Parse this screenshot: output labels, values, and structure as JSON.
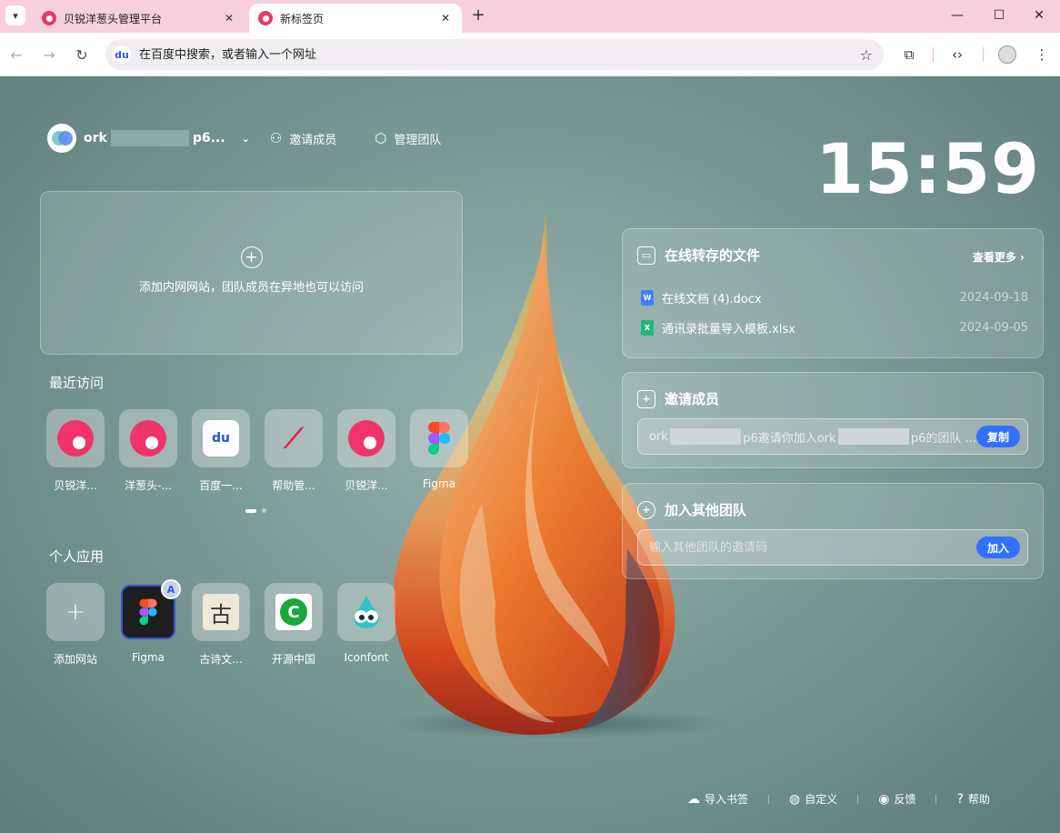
{
  "tabs": [
    {
      "label": "贝锐洋葱头管理平台",
      "active": false
    },
    {
      "label": "新标签页",
      "active": true
    }
  ],
  "omnibox": {
    "placeholder": "在百度中搜索，或者输入一个网址"
  },
  "team": {
    "name_start": "ork",
    "name_end": "p6...",
    "invite_label": "邀请成员",
    "manage_label": "管理团队"
  },
  "clock": "15:59",
  "intranet": {
    "hint": "添加内网网站，团队成员在异地也可以访问"
  },
  "recent": {
    "title": "最近访问",
    "items": [
      {
        "label": "贝锐洋...",
        "icon": "onion-logo"
      },
      {
        "label": "洋葱头-...",
        "icon": "onion-logo"
      },
      {
        "label": "百度一...",
        "icon": "baidu-logo"
      },
      {
        "label": "帮助管...",
        "icon": "trend-logo"
      },
      {
        "label": "贝锐洋...",
        "icon": "onion-logo"
      },
      {
        "label": "Figma",
        "icon": "figma-logo"
      }
    ]
  },
  "personal": {
    "title": "个人应用",
    "items": [
      {
        "label": "添加网站",
        "icon": "plus-icon"
      },
      {
        "label": "Figma",
        "icon": "figma-logo",
        "badge": "A"
      },
      {
        "label": "古诗文...",
        "icon": "gushiwen-logo",
        "glyph": "古"
      },
      {
        "label": "开源中国",
        "icon": "oschina-logo",
        "glyph": "C"
      },
      {
        "label": "Iconfont",
        "icon": "iconfont-logo"
      }
    ]
  },
  "files_card": {
    "title": "在线转存的文件",
    "see_more": "查看更多",
    "files": [
      {
        "name": "在线文档 (4).docx",
        "date": "2024-09-18",
        "type": "W",
        "color": "#3b82f6"
      },
      {
        "name": "通讯录批量导入模板.xlsx",
        "date": "2024-09-05",
        "type": "X",
        "color": "#22b57a"
      }
    ]
  },
  "invite_card": {
    "title": "邀请成员",
    "text_start": "ork",
    "text_middle": "p6邀请你加入ork",
    "text_end": "p6的团队 ...",
    "button": "复制"
  },
  "join_card": {
    "title": "加入其他团队",
    "placeholder": "输入其他团队的邀请码",
    "button": "加入"
  },
  "footer": {
    "import": "导入书签",
    "customize": "自定义",
    "feedback": "反馈",
    "help": "帮助"
  }
}
